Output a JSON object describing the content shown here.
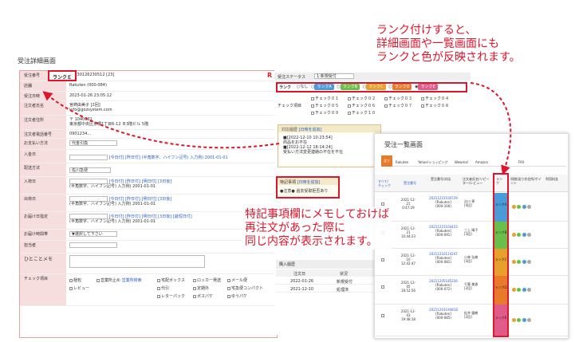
{
  "page_title": "受注詳細画面",
  "detail": {
    "rows": [
      {
        "label": "受注番号",
        "value": "20230126230512 [23]"
      },
      {
        "label": "店舗",
        "value": "Rakuten (000-084)"
      },
      {
        "label": "受注日時",
        "value": "2023-01-26  23:05:12"
      },
      {
        "label": "注文者氏名",
        "value": "宮崎由美子 [2回]"
      },
      {
        "label": "",
        "value": "info@gozsystem.com"
      },
      {
        "label": "注文者住所",
        "value": "〒 1040031"
      },
      {
        "label": "",
        "value": "東京都中央区京橋1丁目6-12 Ｂ3階ビル 5階"
      },
      {
        "label": "注文者電話番号",
        "value": "0901234..."
      },
      {
        "label": "お支払い方法",
        "value": "代金引換"
      },
      {
        "label": "入金日",
        "value": "[今日付] [昨日付] (半角数字、ハイフン記号) 入力例) 2001-01-01"
      },
      {
        "label": "配送方法",
        "value": "佐川急便"
      },
      {
        "label": "入荷日",
        "value": "[今日付] [昨日付] [明日付] [3日後]"
      },
      {
        "label": "",
        "value": "(半角数字、ハイフン記号) 入力例) 2001-01-01"
      },
      {
        "label": "出荷日",
        "value": "[今日付] [昨日付] [明日付] [3日後]"
      },
      {
        "label": "",
        "value": "(半角数字、ハイフン記号) 入力例) 2001-01-01"
      },
      {
        "label": "お届け日指定",
        "value": "[今日付] [昨日付] [明日付] [3日後] [最短日付]"
      },
      {
        "label": "",
        "value": "(半角数字、ハイフン記号) 入力例) 2001-01-01"
      },
      {
        "label": "お届け時間帯",
        "value": "▼選択して下さい"
      },
      {
        "label": "担当者",
        "value": ""
      },
      {
        "label": "ひとことメモ",
        "value": ""
      },
      {
        "label": "チェック項目",
        "value": ""
      }
    ],
    "rank_badge": "ランクＥ",
    "r_mark": "R",
    "check_items": [
      "宅配ボックス",
      "ロッカー発送",
      "メール便",
      "梱包",
      "営業所止め",
      "営業所検索",
      "代引",
      "定期外",
      "宅急便コンパクト",
      "レビュー",
      "レターパック",
      "ポスパケ",
      "ゆうパケ"
    ]
  },
  "status": {
    "label": "受注ステータス",
    "value": "1:新規受付",
    "rank_label": "ランク",
    "rank_none": "なし",
    "ranks": [
      "ランクA",
      "ランクB",
      "ランクC",
      "ランクD",
      "ランクE"
    ],
    "rank_colors": [
      "#4a9bd8",
      "#6abf4b",
      "#e8a02c",
      "#e87a2c",
      "#e05a8a"
    ],
    "check_label": "チェック項目",
    "checks": [
      "チェック０１",
      "チェック０２",
      "チェック０３",
      "チェック０４",
      "チェック０５",
      "チェック０６",
      "チェック０７",
      "チェック０８",
      "チェック０９",
      "チェック１０"
    ],
    "memo": {
      "title": "対応履歴",
      "link": "[日時を追加]",
      "lines": [
        "■[2022-12-10 10:23:54]",
        "商品をお不在",
        "■[2022-12-12 18:14:24]",
        "受払い方法変更連絡の不在を不在"
      ]
    },
    "special": {
      "title": "特記事項",
      "link": "[日時を追加]",
      "body": "●注意● 過去受取拒否あり"
    },
    "history": {
      "title": "購入履歴",
      "headers": [
        "注文日",
        "状況"
      ],
      "rows": [
        [
          "2022-01-26",
          "新規受付"
        ],
        [
          "2021-12-10",
          "処理済"
        ]
      ]
    }
  },
  "list": {
    "title": "受注一覧画面",
    "tabs": [
      "全て",
      "Rakuten",
      "Yahoo!ショッピング",
      "Wowma!",
      "Amazon",
      "FAX"
    ],
    "headers": [
      "すべて/チェック",
      "受注番号",
      "受注番号/対応",
      "注文者氏名/リピーター/レビュー",
      "ランク",
      "同梱/送り先住所/ポイント",
      "利用料金"
    ],
    "rows": [
      {
        "date": "2021-12-21 0:47:29",
        "order": "20211221100729",
        "shop": "[Rakuten]",
        "code": "(000-100)",
        "name": "吉川 恵",
        "tag": "[4回]",
        "rank": "ランクA",
        "color": "#4a9bd8"
      },
      {
        "date": "2021-12-21 10:44:23",
        "order": "20211221104423",
        "shop": "[Rakuten]",
        "code": "(000-091)",
        "name": "三上 晴子",
        "tag": "[3回]",
        "rank": "ランクB",
        "color": "#6abf4b"
      },
      {
        "date": "2021-12-10 12:42:47",
        "order": "20211210124247",
        "shop": "[Rakuten]",
        "code": "(000-081)",
        "name": "小林 弘樹",
        "tag": "[3回]",
        "rank": "ランクC",
        "color": "#e8a02c"
      },
      {
        "date": "2021-12-05 18:52:56",
        "order": "20211205185256",
        "shop": "[Rakuten]",
        "code": "(000-072)",
        "name": "千葉 美香",
        "tag": "[2回]",
        "rank": "ランクD",
        "color": "#e87a2c"
      },
      {
        "date": "2021-12-03 19:48:18",
        "order": "20211203194818",
        "shop": "[Rakuten]",
        "code": "(000-085)",
        "name": "松井 優樹",
        "tag": "[2回]",
        "rank": "ランクE",
        "color": "#e05a8a"
      }
    ]
  },
  "annotations": {
    "top": [
      "ランク付けすると、",
      "詳細画面や一覧画面にも",
      "ランクと色が反映されます。"
    ],
    "middle": [
      "特記事項欄にメモしておけば",
      "再注文があった際に",
      "同じ内容が表示されます。"
    ]
  },
  "accent": "#e0142b"
}
